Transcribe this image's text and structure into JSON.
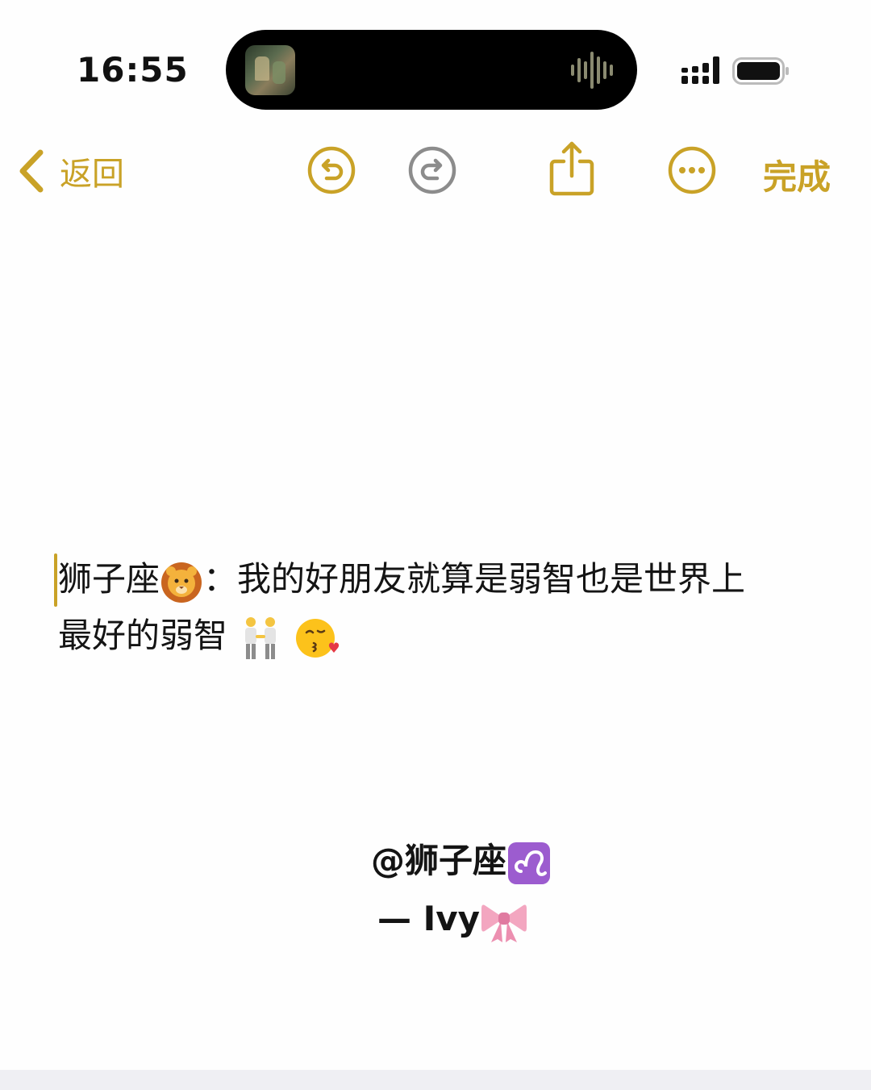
{
  "status_bar": {
    "time": "16:55"
  },
  "toolbar": {
    "back_label": "返回",
    "done_label": "完成",
    "accent_color": "#c9a227"
  },
  "note": {
    "line1_prefix": "狮子座",
    "line1_suffix": "：我的好朋友就算是弱智也是世界上",
    "line2_text": "最好的弱智",
    "signature_handle": "@狮子座",
    "signature_name": "— Ivy"
  },
  "icons": {
    "back": "chevron-left-icon",
    "undo": "undo-icon",
    "redo": "redo-icon",
    "share": "share-icon",
    "more": "ellipsis-circle-icon",
    "emoji_lion": "lion-face-emoji",
    "emoji_people": "two-men-holding-hands-emoji",
    "emoji_kiss": "face-blowing-kiss-emoji",
    "emoji_leo": "leo-zodiac-emoji",
    "emoji_bow": "ribbon-emoji"
  }
}
